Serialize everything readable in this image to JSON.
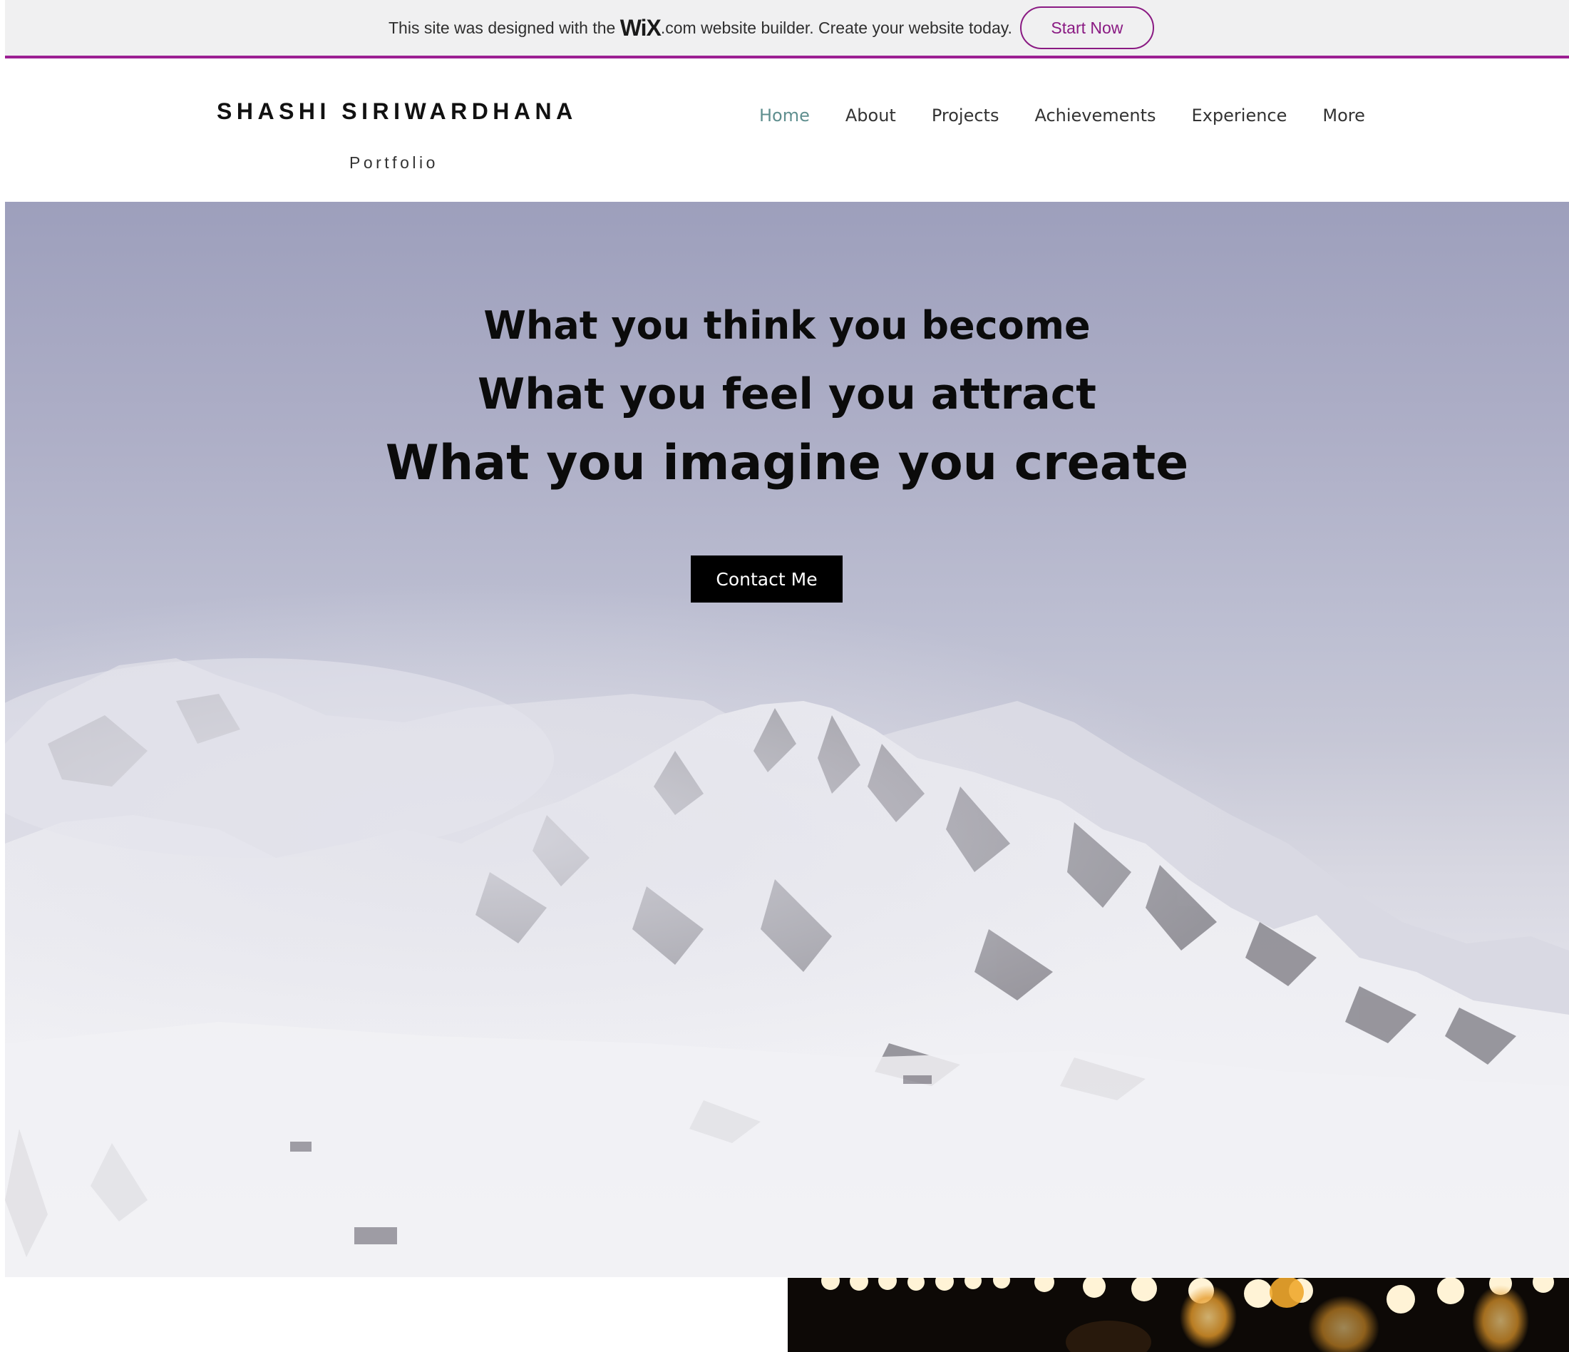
{
  "banner": {
    "text_before": "This site was designed with the",
    "logo": "WiX",
    "text_after": ".com website builder. Create your website today.",
    "cta_label": "Start Now",
    "accent": "#9c1f93"
  },
  "header": {
    "site_title": "SHASHI SIRIWARDHANA",
    "subtitle": "Portfolio",
    "nav": [
      {
        "label": "Home",
        "active": true
      },
      {
        "label": "About"
      },
      {
        "label": "Projects"
      },
      {
        "label": "Achievements"
      },
      {
        "label": "Experience"
      },
      {
        "label": "More"
      }
    ]
  },
  "hero": {
    "line1": "What you think you become",
    "line2": "What you feel you attract",
    "line3": "What you imagine you create",
    "contact_label": "Contact Me",
    "background": "snowy-mountains-image"
  },
  "footer_image": "bokeh-lights-image"
}
